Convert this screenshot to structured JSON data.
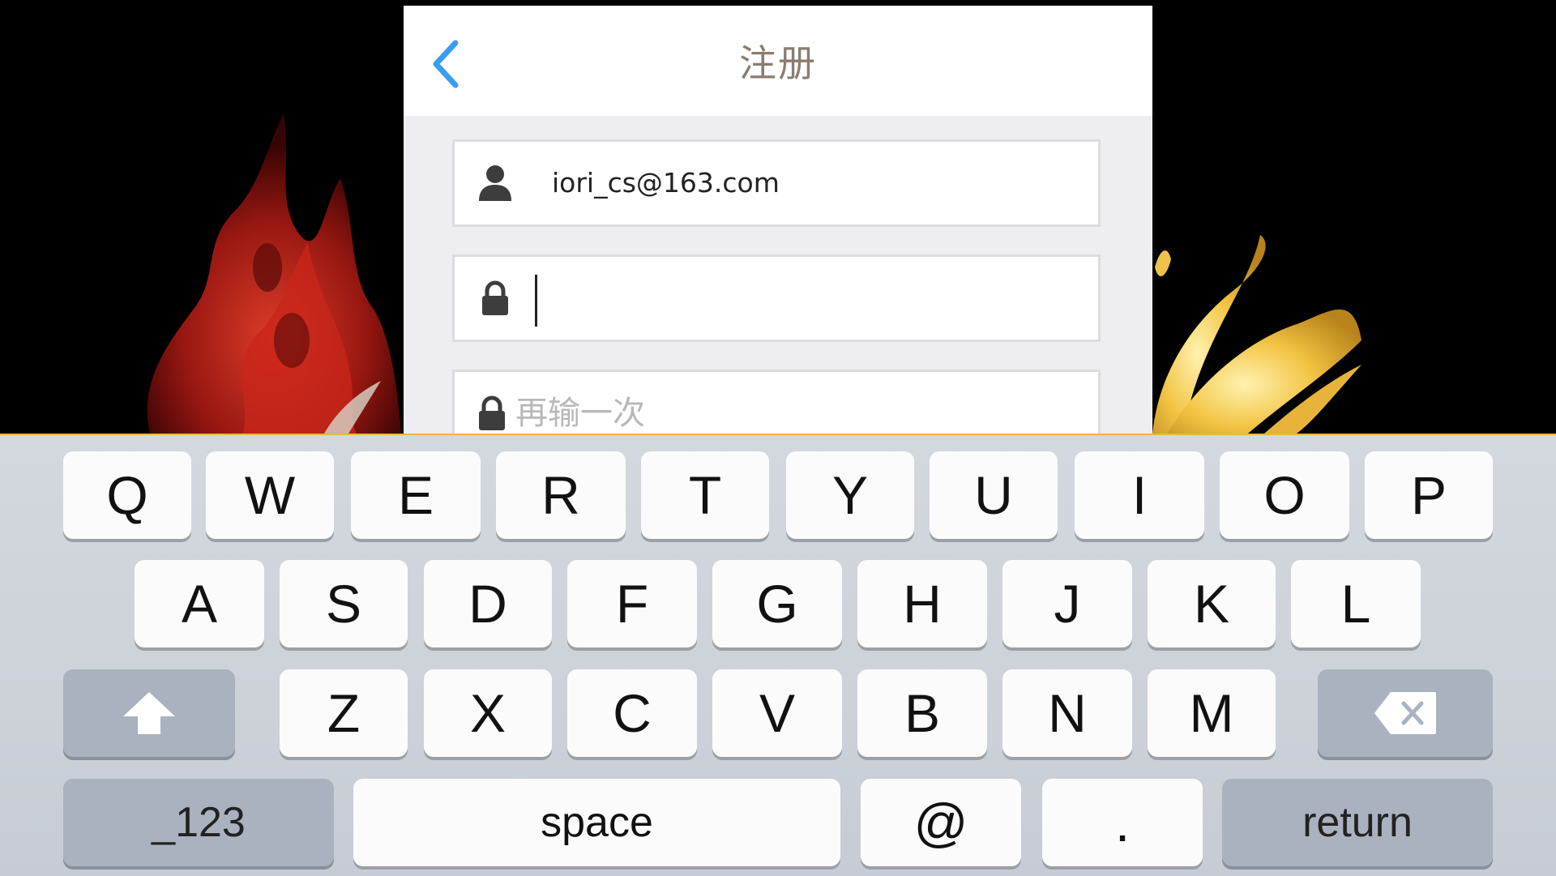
{
  "dialog": {
    "title": "注册",
    "email_value": "iori_cs@163.com",
    "confirm_placeholder": "再输一次",
    "icons": {
      "back": "chevron-left-icon",
      "user": "user-icon",
      "lock": "lock-icon"
    },
    "colors": {
      "accent": "#3a9ef0",
      "title": "#8a7d70"
    }
  },
  "keyboard": {
    "row1": [
      "Q",
      "W",
      "E",
      "R",
      "T",
      "Y",
      "U",
      "I",
      "O",
      "P"
    ],
    "row2": [
      "A",
      "S",
      "D",
      "F",
      "G",
      "H",
      "J",
      "K",
      "L"
    ],
    "row3": [
      "Z",
      "X",
      "C",
      "V",
      "B",
      "N",
      "M"
    ],
    "numbers_label": "_123",
    "space_label": "space",
    "at_label": "@",
    "dot_label": ".",
    "return_label": "return",
    "icons": {
      "shift": "shift-arrow-icon",
      "delete": "backspace-icon"
    }
  }
}
